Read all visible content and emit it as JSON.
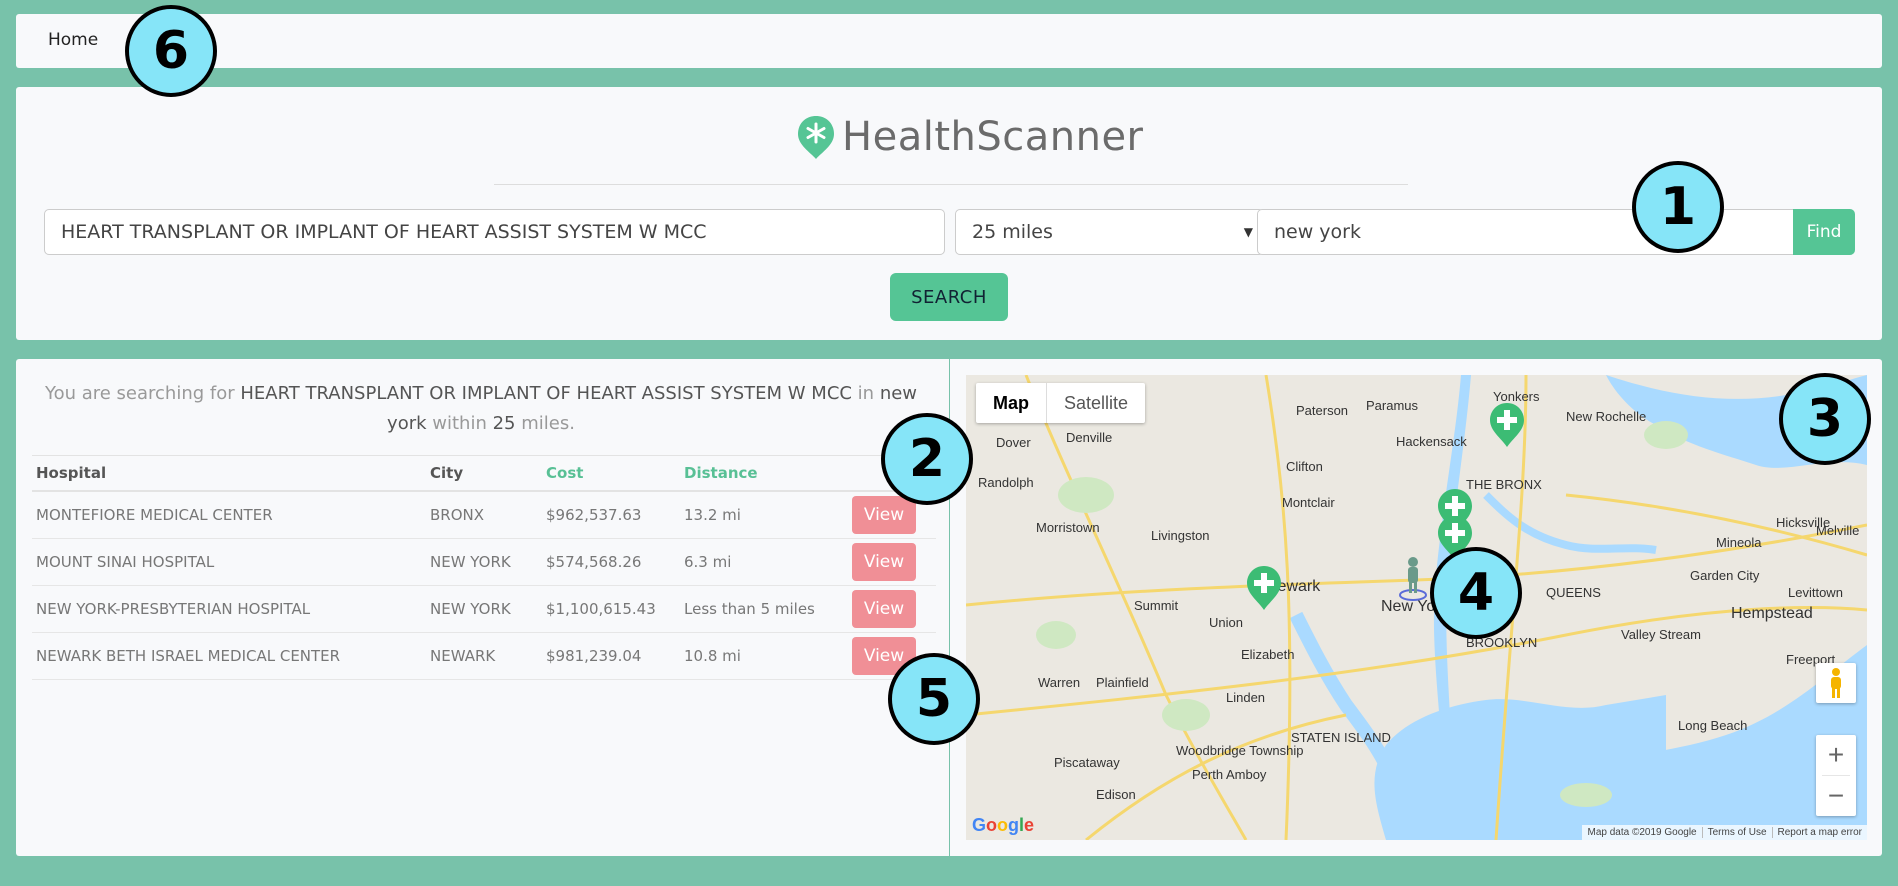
{
  "nav": {
    "home_label": "Home"
  },
  "brand": {
    "name": "HealthScanner",
    "accent_color": "#55c595"
  },
  "search": {
    "procedure_value": "HEART TRANSPLANT OR IMPLANT OF HEART ASSIST SYSTEM W MCC",
    "radius_value": "25 miles",
    "location_value": "new york",
    "find_label": "Find",
    "search_label": "SEARCH"
  },
  "summary": {
    "prefix": "You are searching for ",
    "procedure": "HEART TRANSPLANT OR IMPLANT OF HEART ASSIST SYSTEM W MCC",
    "in_word": " in ",
    "location": "new york",
    "within_word": " within ",
    "radius": "25",
    "suffix": " miles."
  },
  "table": {
    "headers": {
      "hospital": "Hospital",
      "city": "City",
      "cost": "Cost",
      "distance": "Distance"
    },
    "view_label": "View",
    "rows": [
      {
        "hospital": "MONTEFIORE MEDICAL CENTER",
        "city": "BRONX",
        "cost": "$962,537.63",
        "distance": "13.2 mi"
      },
      {
        "hospital": "MOUNT SINAI HOSPITAL",
        "city": "NEW YORK",
        "cost": "$574,568.26",
        "distance": "6.3 mi"
      },
      {
        "hospital": "NEW YORK-PRESBYTERIAN HOSPITAL",
        "city": "NEW YORK",
        "cost": "$1,100,615.43",
        "distance": "Less than 5 miles"
      },
      {
        "hospital": "NEWARK BETH ISRAEL MEDICAL CENTER",
        "city": "NEWARK",
        "cost": "$981,239.04",
        "distance": "10.8 mi"
      }
    ]
  },
  "map": {
    "type_map": "Map",
    "type_satellite": "Satellite",
    "zoom_in": "+",
    "zoom_out": "−",
    "google_logo": "Google",
    "attribution": {
      "data": "Map data ©2019 Google",
      "terms": "Terms of Use",
      "report": "Report a map error"
    },
    "labels": {
      "paterson": "Paterson",
      "yonkers": "Yonkers",
      "new_rochelle": "New Rochelle",
      "clifton": "Clifton",
      "newark": "Newark",
      "new_york": "New York",
      "union": "Union",
      "elizabeth": "Elizabeth",
      "queens": "QUEENS",
      "hempstead": "Hempstead",
      "brooklyn": "BROOKLYN",
      "staten_island": "STATEN ISLAND",
      "edison": "Edison",
      "long_beach": "Long Beach",
      "mineola": "Mineola",
      "valley_stream": "Valley Stream",
      "freeport": "Freeport",
      "levittown": "Levittown",
      "garden_city": "Garden City",
      "the_bronx": "THE BRONX",
      "hackensack": "Hackensack",
      "montclair": "Montclair",
      "livingston": "Livingston",
      "morristown": "Morristown",
      "summit": "Summit",
      "plainfield": "Plainfield",
      "linden": "Linden",
      "woodbridge": "Woodbridge Township",
      "perth_amboy": "Perth Amboy",
      "piscataway": "Piscataway",
      "warren": "Warren",
      "denville": "Denville",
      "dover": "Dover",
      "randolph": "Randolph",
      "paramus": "Paramus",
      "hicksville": "Hicksville",
      "melville": "Melville"
    }
  },
  "annotations": {
    "b1": "1",
    "b2": "2",
    "b3": "3",
    "b4": "4",
    "b5": "5",
    "b6": "6"
  }
}
